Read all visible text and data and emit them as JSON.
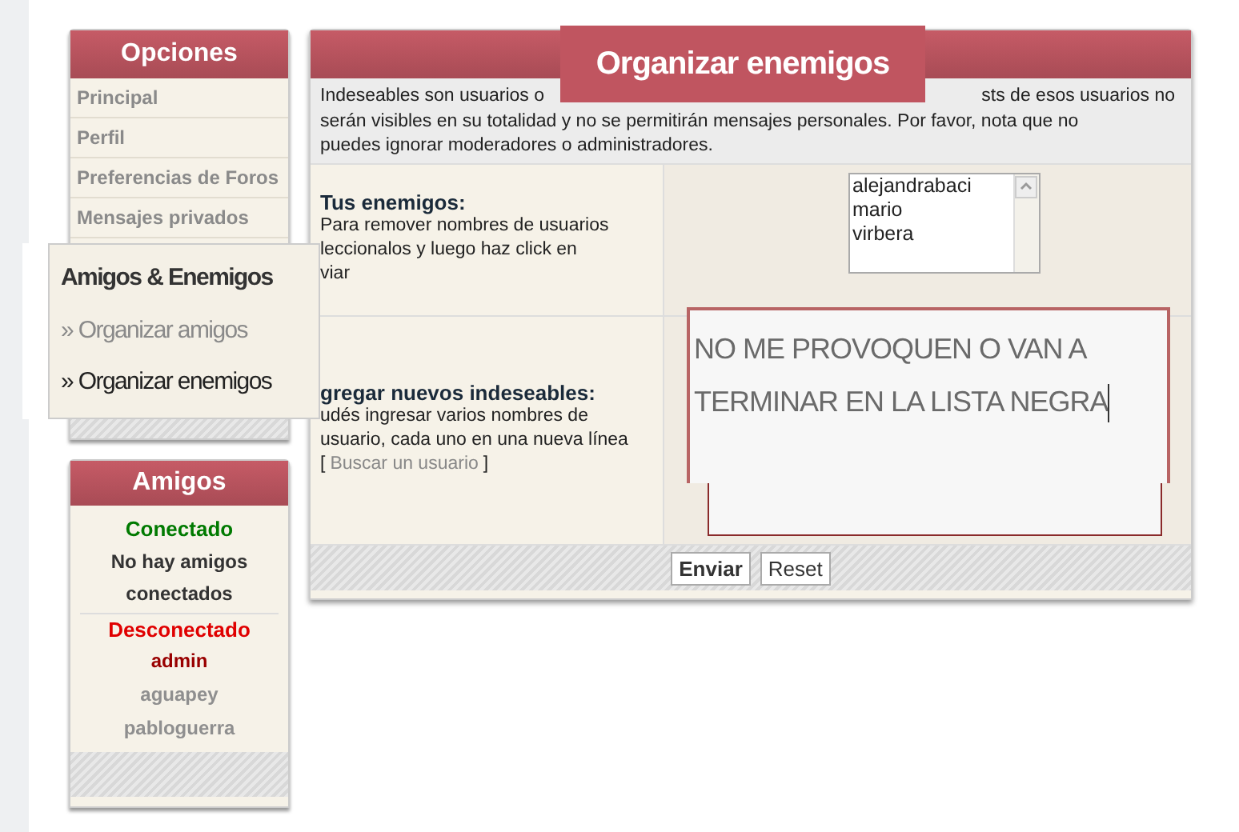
{
  "options_panel": {
    "title": "Opciones",
    "items": [
      "Principal",
      "Perfil",
      "Preferencias de Foros",
      "Mensajes privados"
    ]
  },
  "friends_panel": {
    "title": "Amigos",
    "online_heading": "Conectado",
    "online_empty": "No hay amigos conectados",
    "offline_heading": "Desconectado",
    "offline_users": [
      {
        "name": "admin",
        "color": "#990000"
      },
      {
        "name": "aguapey",
        "color": "#8f8f8f"
      },
      {
        "name": "pabloguerra",
        "color": "#8f8f8f"
      }
    ]
  },
  "zoom_menu": {
    "heading": "Amigos & Enemigos",
    "items": [
      {
        "label": "» Organizar amigos",
        "selected": false
      },
      {
        "label": "» Organizar enemigos",
        "selected": true
      }
    ]
  },
  "main_panel": {
    "title": "Organizar enemigos",
    "description": [
      "Indeseables son usuarios o",
      "sts de esos usuarios no",
      "serán visibles en su totalidad y no se permitirán mensajes personales. Por favor, nota que no",
      "puedes ignorar moderadores o administradores."
    ],
    "enemies": {
      "label": "Tus enemigos:",
      "help": [
        "Para remover nombres de usuarios",
        "leccionalos y luego haz click en",
        "viar"
      ],
      "users": [
        "alejandrabaci",
        "mario",
        "virbera"
      ]
    },
    "add": {
      "label": "gregar nuevos indeseables:",
      "help": [
        "udés ingresar varios nombres de",
        "usuario, cada uno en una nueva línea"
      ],
      "link_open": "[",
      "link": "Buscar un usuario",
      "link_close": "]",
      "value": "NO ME PROVOQUEN O VAN A TERMINAR EN LA LISTA NEGRA"
    },
    "buttons": [
      {
        "label": "Enviar",
        "kind": "primary"
      },
      {
        "label": "Reset",
        "kind": "secondary"
      }
    ]
  }
}
